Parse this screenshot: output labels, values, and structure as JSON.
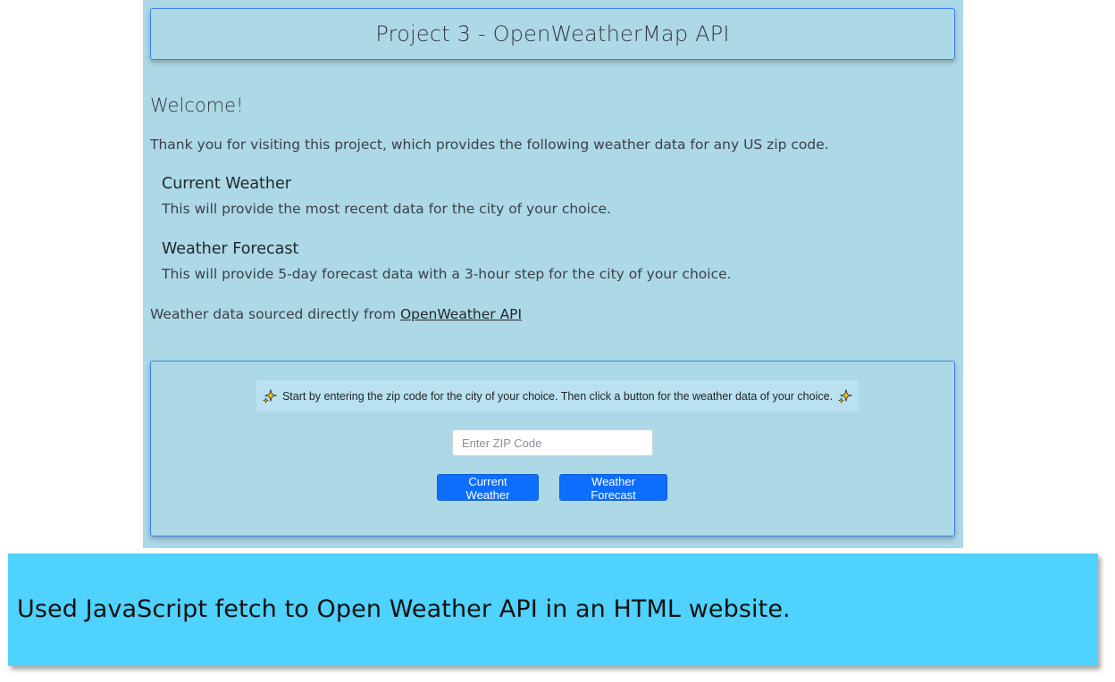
{
  "header": {
    "title": "Project 3 - OpenWeatherMap API"
  },
  "intro": {
    "welcome": "Welcome!",
    "text": "Thank you for visiting this project, which provides the following weather data for any US zip code."
  },
  "features": [
    {
      "title": "Current Weather",
      "description": "This will provide the most recent data for the city of your choice."
    },
    {
      "title": "Weather Forecast",
      "description": "This will provide 5-day forecast data with a 3-hour step for the city of your choice."
    }
  ],
  "source": {
    "prefix": "Weather data sourced directly from ",
    "link_label": "OpenWeather API"
  },
  "form": {
    "instruction": "Start by entering the zip code for the city of your choice. Then click a button for the weather data of your choice.",
    "instruction_icon": "sparkles-icon",
    "zip_placeholder": "Enter ZIP Code",
    "zip_value": "",
    "current_button": "Current Weather",
    "forecast_button": "Weather Forecast"
  },
  "caption": {
    "text": "Used JavaScript fetch to Open Weather API in an HTML website."
  },
  "colors": {
    "page_background": "#add8e6",
    "accent_border": "#3b82f6",
    "button_primary": "#0d6efd",
    "caption_background": "#4fd2fd"
  }
}
